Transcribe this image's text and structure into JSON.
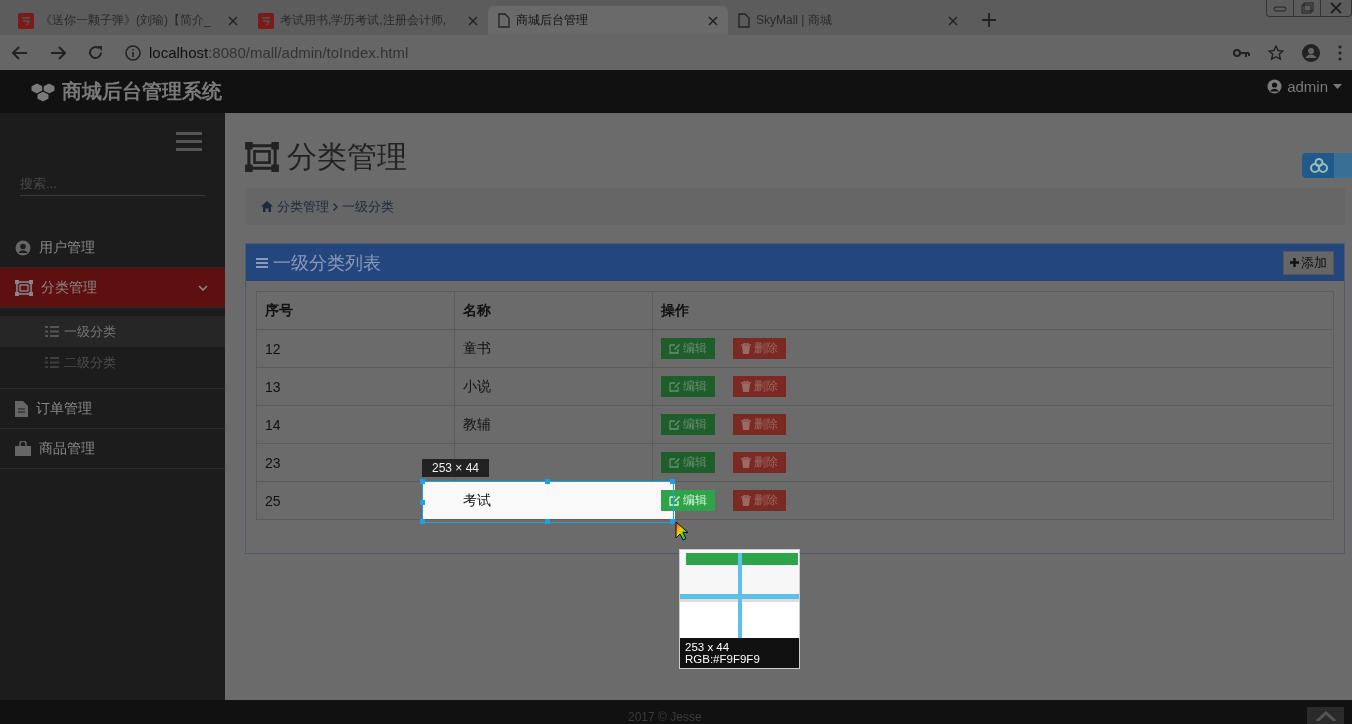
{
  "browser": {
    "tabs": [
      {
        "title": "《送你一颗子弹》(刘瑜)【简介_",
        "kind": "site",
        "selected": false
      },
      {
        "title": "考试用书,学历考试,注册会计师,",
        "kind": "site",
        "selected": false
      },
      {
        "title": "商城后台管理",
        "kind": "page",
        "selected": true
      },
      {
        "title": "SkyMall | 商城",
        "kind": "page",
        "selected": false
      }
    ],
    "url_host": "localhost",
    "url_path": ":8080/mall/admin/toIndex.html"
  },
  "app": {
    "brand": "商城后台管理系统",
    "user": "admin"
  },
  "sidebar": {
    "search_placeholder": "搜索...",
    "items": [
      {
        "label": "用户管理",
        "kind": "user",
        "selected": false
      },
      {
        "label": "分类管理",
        "kind": "frame",
        "selected": true,
        "expanded": true,
        "children": [
          {
            "label": "一级分类",
            "selected": true
          },
          {
            "label": "二级分类",
            "selected": false
          }
        ]
      },
      {
        "label": "订单管理",
        "kind": "file",
        "selected": false
      },
      {
        "label": "商品管理",
        "kind": "bag",
        "selected": false
      }
    ]
  },
  "main": {
    "title": "分类管理",
    "breadcrumb": [
      "分类管理",
      "一级分类"
    ],
    "panel": {
      "title": "一级分类列表",
      "add_button": "添加",
      "table": {
        "columns": [
          "序号",
          "名称",
          "操作"
        ],
        "rows": [
          {
            "id": "12",
            "name": "童书",
            "edit": "编辑",
            "delete": "删除"
          },
          {
            "id": "13",
            "name": "小说",
            "edit": "编辑",
            "delete": "删除"
          },
          {
            "id": "14",
            "name": "教辅",
            "edit": "编辑",
            "delete": "删除"
          },
          {
            "id": "23",
            "edit": "编辑",
            "delete": "删除"
          },
          {
            "id": "25",
            "name": "考试",
            "edit": "编辑",
            "delete": "删除",
            "highlighted": true
          }
        ]
      }
    }
  },
  "footer": "2017 © Jesse",
  "capture": {
    "size_label": "253 × 44",
    "magnifier_size": "253 x 44",
    "magnifier_color": "RGB:#F9F9F9"
  }
}
